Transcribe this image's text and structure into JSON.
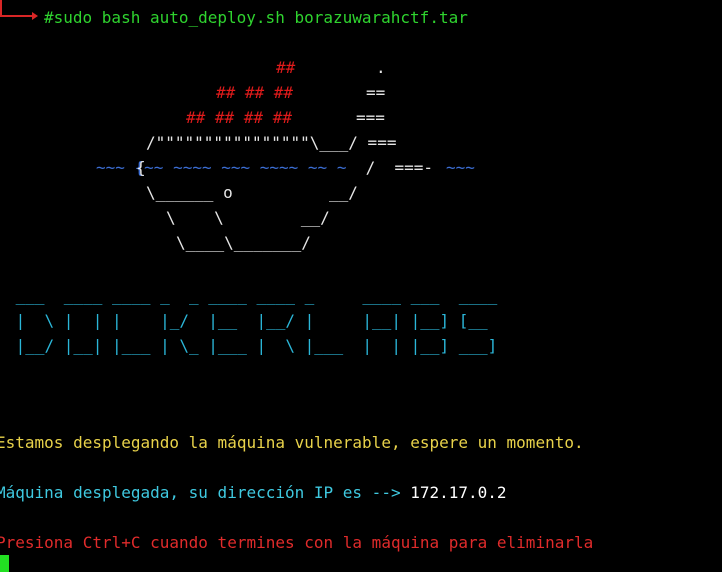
{
  "prompt": {
    "command": "#sudo bash auto_deploy.sh borazuwarahctf.tar",
    "cut_off_line": "[   ]   ·  [        ]   ]     ·    ]   ·  ]"
  },
  "whale_art": {
    "row1_red": "##",
    "row1_white": ".",
    "row2_red": "## ## ##",
    "row2_white": "==",
    "row3_red": "## ## ## ##",
    "row3_white": "===",
    "row4": "/\"\"\"\"\"\"\"\"\"\"\"\"\"\"\"\"\\___/ ===",
    "row5_wave_left": "~~~ {~~ ~~~~ ~~~ ~~~~ ~~ ~",
    "row5_white": " /  ===- ",
    "row5_wave_right": "~~~",
    "row5_brace": "{",
    "row6": "\\______ o          __/",
    "row7": "\\    \\        __/",
    "row8": "\\____\\_______/"
  },
  "banner": {
    "line1": " ___  ____ ____ _  _ ____ ____ _     ____ ___  ____",
    "line2": " |  \\ |  | |    |_/  |__  |__/ |     |__| |__] [__",
    "line3": " |__/ |__| |___ | \\_ |___ |  \\ |___  |  | |__] ___]"
  },
  "messages": {
    "deploying": "Estamos desplegando la máquina vulnerable, espere un momento.",
    "deployed_prefix": "Máquina desplegada, su dirección IP es -->",
    "ip_address": "172.17.0.2",
    "instruction": "Presiona Ctrl+C cuando termines con la máquina para eliminarla"
  }
}
